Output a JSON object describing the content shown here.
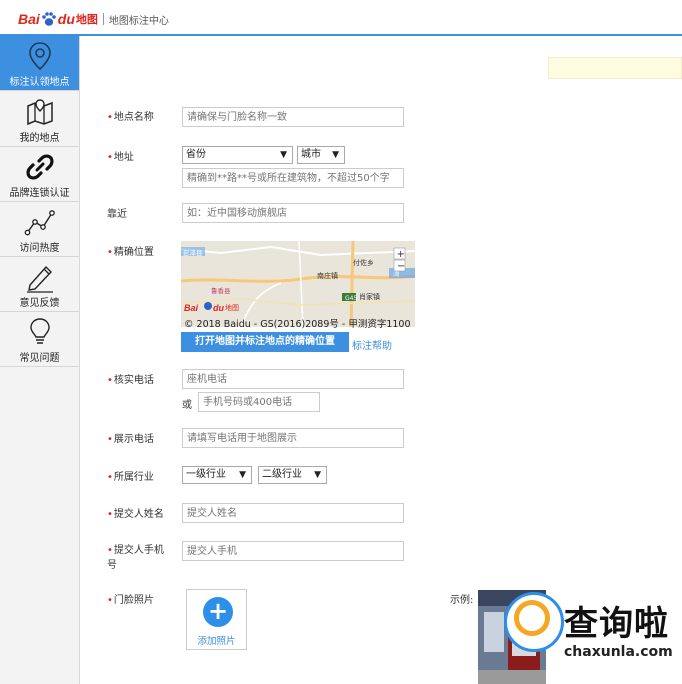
{
  "header": {
    "logo_bai": "Bai",
    "logo_du": "du",
    "logo_map": "地图",
    "title": "地图标注中心"
  },
  "sidebar": {
    "items": [
      {
        "label": "标注认领地点",
        "icon": "location-pin-icon",
        "active": true
      },
      {
        "label": "我的地点",
        "icon": "map-icon"
      },
      {
        "label": "品牌连锁认证",
        "icon": "link-icon"
      },
      {
        "label": "访问热度",
        "icon": "trend-line-icon"
      },
      {
        "label": "意见反馈",
        "icon": "pencil-icon"
      },
      {
        "label": "常见问题",
        "icon": "lightbulb-icon"
      }
    ]
  },
  "form": {
    "name": {
      "label": "地点名称",
      "placeholder": "请确保与门脸名称一致"
    },
    "address": {
      "label": "地址",
      "province": "省份",
      "city": "城市",
      "detail_placeholder": "精确到**路**号或所在建筑物，不超过50个字"
    },
    "nearby": {
      "label": "靠近",
      "placeholder": "如：近中国移动旗舰店"
    },
    "position": {
      "label": "精确位置",
      "map_copyright": "© 2018 Baidu - GS(2016)2089号 - 甲测资字1100",
      "open_map_button": "打开地图并标注地点的精确位置",
      "help_link": "标注帮助",
      "map_labels": {
        "town1": "南庄镇",
        "town2": "付佐乡",
        "town3": "肖家镇",
        "town4": "彭泽县",
        "road": "G45",
        "place1": "鲁香县",
        "place2": "湾"
      }
    },
    "verify_phone": {
      "label": "核实电话",
      "landline_placeholder": "座机电话",
      "or": "或",
      "mobile_placeholder": "手机号码或400电话"
    },
    "display_phone": {
      "label": "展示电话",
      "placeholder": "请填写电话用于地图展示"
    },
    "industry": {
      "label": "所属行业",
      "level1": "一级行业",
      "level2": "二级行业"
    },
    "submitter_name": {
      "label": "提交人姓名",
      "placeholder": "提交人姓名"
    },
    "submitter_phone": {
      "label_line1": "提交人手机",
      "label_line2": "号",
      "placeholder": "提交人手机"
    },
    "photo": {
      "label": "门脸照片",
      "add_label": "添加照片",
      "example_label": "示例:"
    }
  },
  "watermark": {
    "text": "查询啦",
    "domain": "chaxunla.com"
  },
  "colors": {
    "accent": "#3d8fe0",
    "required": "#e1251b",
    "brand_red": "#e1251b"
  }
}
